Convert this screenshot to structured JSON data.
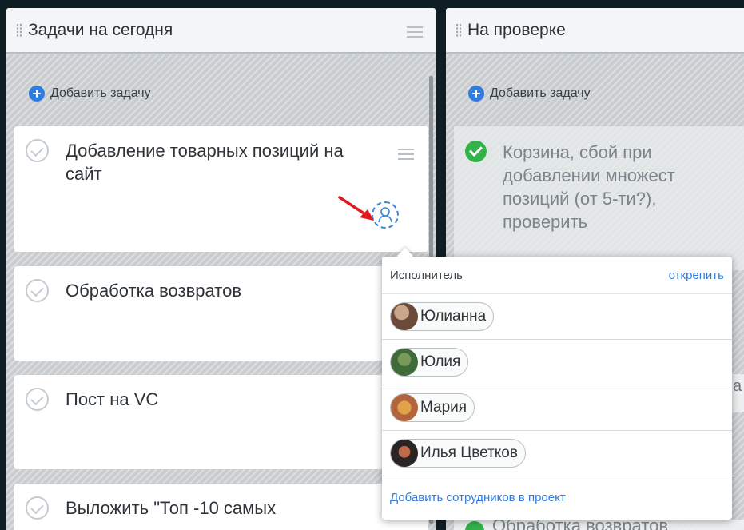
{
  "columns": [
    {
      "title": "Задачи на сегодня",
      "add_label": "Добавить задачу",
      "cards": [
        {
          "title": "Добавление товарных позиций на сайт"
        },
        {
          "title": "Обработка возвратов"
        },
        {
          "title": "Пост на VC"
        },
        {
          "title": "Выложить \"Топ -10 самых"
        }
      ]
    },
    {
      "title": "На проверке",
      "add_label": "Добавить задачу",
      "cards": [
        {
          "title": "Корзина, сбой при добавлении множест позиций (от 5-ти?), проверить",
          "done": true
        },
        {
          "title": "Обработка возвратов",
          "done": true
        }
      ],
      "peek_char": "а"
    }
  ],
  "assignee_popup": {
    "label": "Исполнитель",
    "unpin_label": "открепить",
    "people": [
      {
        "name": "Юлианна",
        "avatar_color": "#6b4a3a"
      },
      {
        "name": "Юлия",
        "avatar_color": "#3f6b3a"
      },
      {
        "name": "Мария",
        "avatar_color": "#b3643a"
      },
      {
        "name": "Илья Цветков",
        "avatar_color": "#2a2424"
      }
    ],
    "add_staff_label": "Добавить сотрудников в проект"
  },
  "colors": {
    "accent": "#2f7de1",
    "done": "#33b249",
    "annotation_arrow": "#e0191e"
  }
}
